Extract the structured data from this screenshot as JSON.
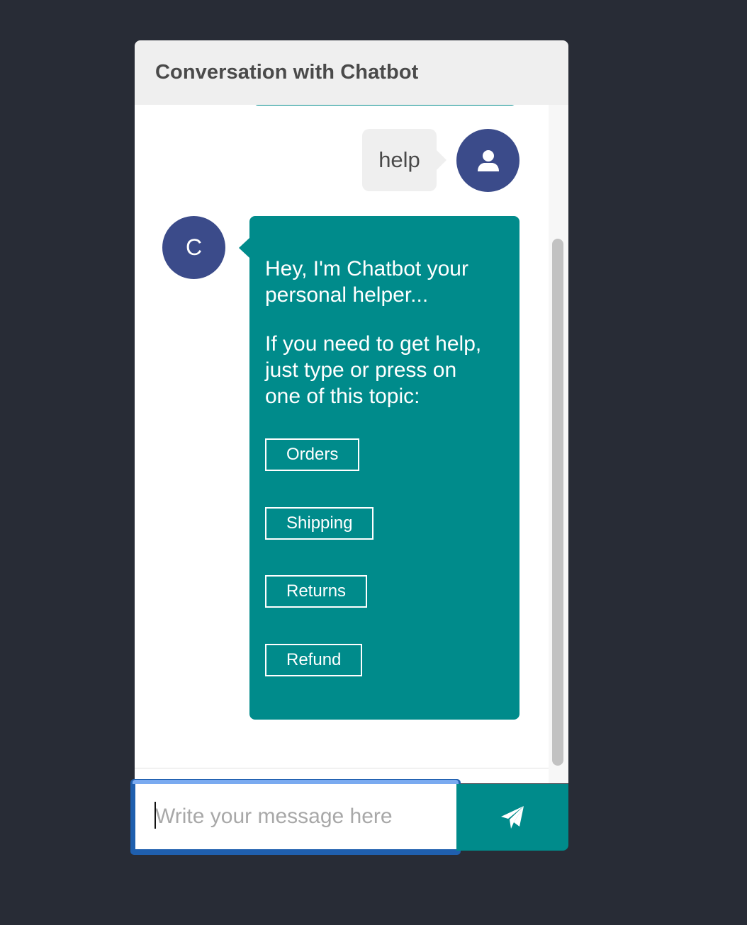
{
  "header": {
    "title": "Conversation with Chatbot"
  },
  "messages": {
    "user": {
      "text": "help",
      "avatar_icon": "user-icon"
    },
    "bot": {
      "avatar_letter": "C",
      "paragraph1_lines": [
        "Hey, I'm Chatbot your",
        "personal helper..."
      ],
      "paragraph2_lines": [
        "If you need to get help,",
        "just type or press on",
        "one of this topic:"
      ],
      "topics": [
        "Orders",
        "Shipping",
        "Returns",
        "Refund"
      ]
    }
  },
  "composer": {
    "placeholder": "Write your message here",
    "value": "",
    "send_icon": "paper-plane-icon"
  },
  "colors": {
    "background": "#282c36",
    "header_bg": "#efefef",
    "bot_bubble": "#008b8b",
    "avatar": "#3b4b8a",
    "user_bubble": "#efefef",
    "send_button": "#008b8b",
    "input_focus_border": "#1f5fae"
  }
}
